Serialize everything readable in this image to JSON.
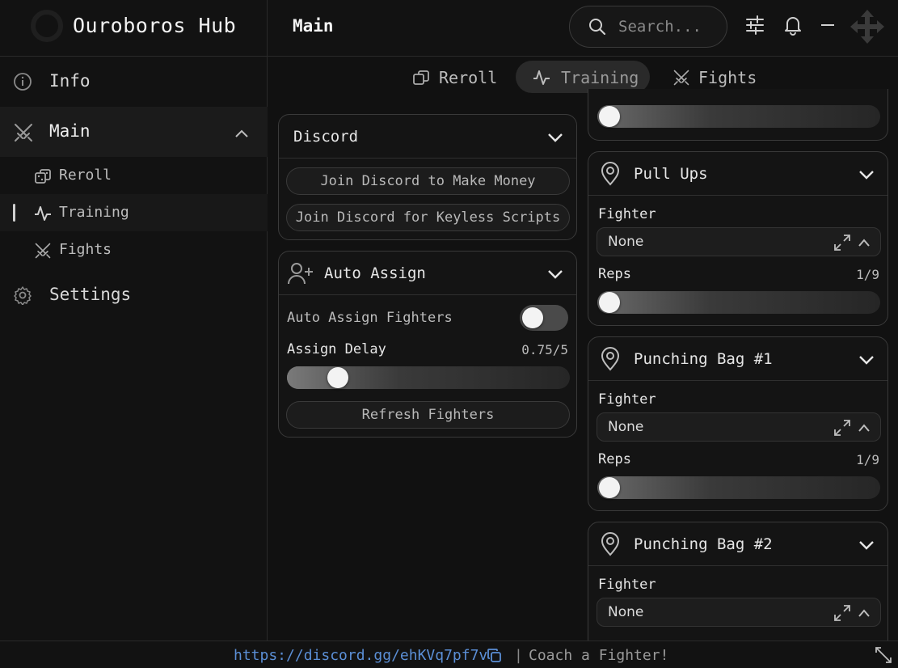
{
  "app": {
    "title": "Ouroboros Hub"
  },
  "header": {
    "page_title": "Main",
    "search_placeholder": "Search..."
  },
  "sidebar": {
    "info": "Info",
    "main": "Main",
    "sub_items": [
      "Reroll",
      "Training",
      "Fights"
    ],
    "settings": "Settings"
  },
  "tabs": [
    {
      "label": "Reroll",
      "active": false
    },
    {
      "label": "Training",
      "active": true
    },
    {
      "label": "Fights",
      "active": false
    }
  ],
  "discord_card": {
    "title": "Discord",
    "buttons": [
      "Join Discord to Make Money",
      "Join Discord for Keyless Scripts"
    ]
  },
  "auto_assign_card": {
    "title": "Auto Assign",
    "toggle_label": "Auto Assign Fighters",
    "toggle_on": false,
    "delay_label": "Assign Delay",
    "delay_value": "0.75/5",
    "delay_fraction": 0.15,
    "refresh_button": "Refresh Fighters"
  },
  "training_cards": [
    {
      "title": "Pull Ups",
      "fighter_label": "Fighter",
      "fighter_value": "None",
      "reps_label": "Reps",
      "reps_value": "1/9"
    },
    {
      "title": "Punching Bag #1",
      "fighter_label": "Fighter",
      "fighter_value": "None",
      "reps_label": "Reps",
      "reps_value": "1/9"
    },
    {
      "title": "Punching Bag #2",
      "fighter_label": "Fighter",
      "fighter_value": "None"
    }
  ],
  "footer": {
    "link": "https://discord.gg/ehKVq7pf7v",
    "separator": "|",
    "message": "Coach a Fighter!"
  },
  "colors": {
    "background": "#111111",
    "panel": "#141414",
    "link": "#5b8fd6",
    "text": "#d6d6d6"
  }
}
